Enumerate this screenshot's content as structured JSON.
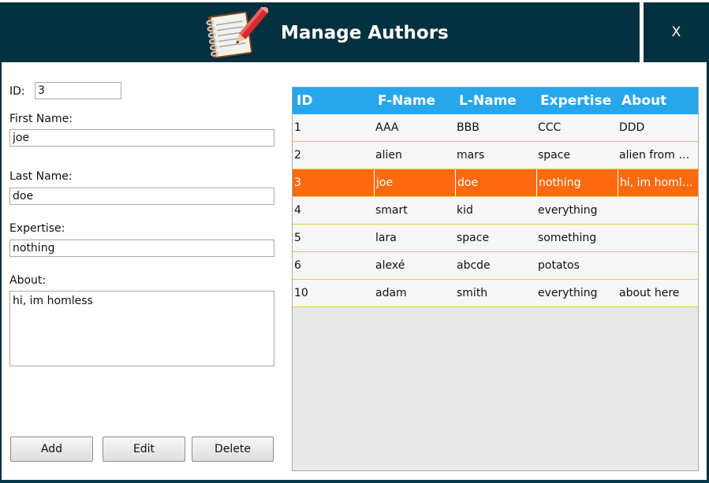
{
  "window": {
    "title": "Manage Authors",
    "close_label": "X"
  },
  "form": {
    "id_label": "ID:",
    "id_value": "3",
    "first_name_label": "First Name:",
    "first_name_value": "joe",
    "last_name_label": "Last Name:",
    "last_name_value": "doe",
    "expertise_label": "Expertise:",
    "expertise_value": "nothing",
    "about_label": "About:",
    "about_value": "hi, im homless"
  },
  "buttons": {
    "add": "Add",
    "edit": "Edit",
    "delete": "Delete"
  },
  "table": {
    "headers": [
      "ID",
      "F-Name",
      "L-Name",
      "Expertise",
      "About"
    ],
    "selected_row": 2,
    "rows": [
      [
        "1",
        "AAA",
        "BBB",
        "CCC",
        "DDD"
      ],
      [
        "2",
        "alien",
        "mars",
        "space",
        "alien from mar..."
      ],
      [
        "3",
        "joe",
        "doe",
        "nothing",
        "hi, im homless"
      ],
      [
        "4",
        "smart",
        "kid",
        "everything",
        ""
      ],
      [
        "5",
        "lara",
        "space",
        "something",
        ""
      ],
      [
        "6",
        "alexé",
        "abcde",
        "potatos",
        ""
      ],
      [
        "10",
        "adam",
        "smith",
        "everything",
        "about here"
      ]
    ]
  },
  "colors": {
    "titlebar": "#04313f",
    "header": "#27a6ec",
    "selection": "#ff6a10",
    "row_border": "#e8cc45"
  },
  "icons": {
    "app": "notebook-pencil-icon"
  }
}
